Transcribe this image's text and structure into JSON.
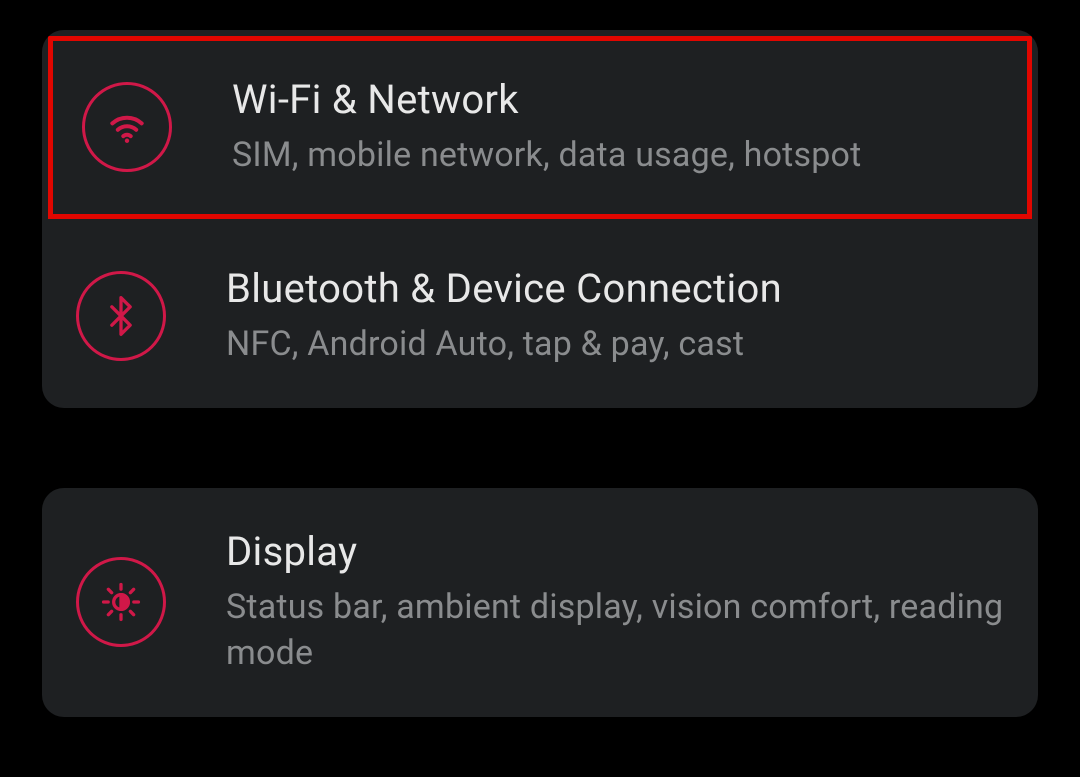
{
  "groups": [
    {
      "items": [
        {
          "id": "wifi-network",
          "title": "Wi-Fi & Network",
          "subtitle": "SIM, mobile network, data usage, hotspot",
          "highlighted": true,
          "icon": "wifi"
        },
        {
          "id": "bluetooth-device",
          "title": "Bluetooth & Device Connection",
          "subtitle": "NFC, Android Auto, tap & pay, cast",
          "highlighted": false,
          "icon": "bluetooth"
        }
      ]
    },
    {
      "items": [
        {
          "id": "display",
          "title": "Display",
          "subtitle": "Status bar, ambient display, vision comfort, reading mode",
          "highlighted": false,
          "icon": "brightness"
        }
      ]
    }
  ],
  "colors": {
    "accent": "#d01848",
    "highlight_border": "#e10600",
    "card_bg": "#1e2022",
    "title": "#e8e8e8",
    "subtitle": "#8a8c8e"
  }
}
